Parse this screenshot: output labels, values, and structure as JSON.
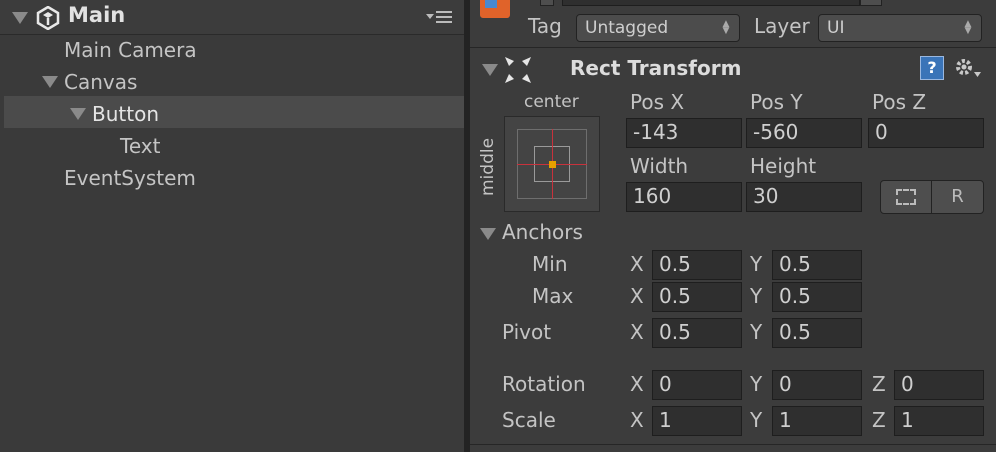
{
  "hierarchy": {
    "scene_name": "Main",
    "items": [
      {
        "label": "Main Camera"
      },
      {
        "label": "Canvas"
      },
      {
        "label": "Button"
      },
      {
        "label": "Text"
      },
      {
        "label": "EventSystem"
      }
    ]
  },
  "inspector": {
    "tag_label": "Tag",
    "tag_value": "Untagged",
    "layer_label": "Layer",
    "layer_value": "UI",
    "component_title": "Rect Transform",
    "anchor_preset": {
      "horizontal": "center",
      "vertical": "middle"
    },
    "pos_x": {
      "label": "Pos X",
      "value": "-143"
    },
    "pos_y": {
      "label": "Pos Y",
      "value": "-560"
    },
    "pos_z": {
      "label": "Pos Z",
      "value": "0"
    },
    "width": {
      "label": "Width",
      "value": "160"
    },
    "height": {
      "label": "Height",
      "value": "30"
    },
    "raw_edit_button": "R",
    "anchors": {
      "label": "Anchors",
      "min": {
        "label": "Min",
        "x_label": "X",
        "x": "0.5",
        "y_label": "Y",
        "y": "0.5"
      },
      "max": {
        "label": "Max",
        "x_label": "X",
        "x": "0.5",
        "y_label": "Y",
        "y": "0.5"
      }
    },
    "pivot": {
      "label": "Pivot",
      "x_label": "X",
      "x": "0.5",
      "y_label": "Y",
      "y": "0.5"
    },
    "rotation": {
      "label": "Rotation",
      "x_label": "X",
      "x": "0",
      "y_label": "Y",
      "y": "0",
      "z_label": "Z",
      "z": "0"
    },
    "scale": {
      "label": "Scale",
      "x_label": "X",
      "x": "1",
      "y_label": "Y",
      "y": "1",
      "z_label": "Z",
      "z": "1"
    }
  },
  "colors": {
    "selection": "#4b4b4b",
    "anchor_crosshair": "#c8323c",
    "anchor_dot": "#e6a000",
    "gameobject_icon": "#e0632a",
    "help_icon": "#3a74b8"
  }
}
